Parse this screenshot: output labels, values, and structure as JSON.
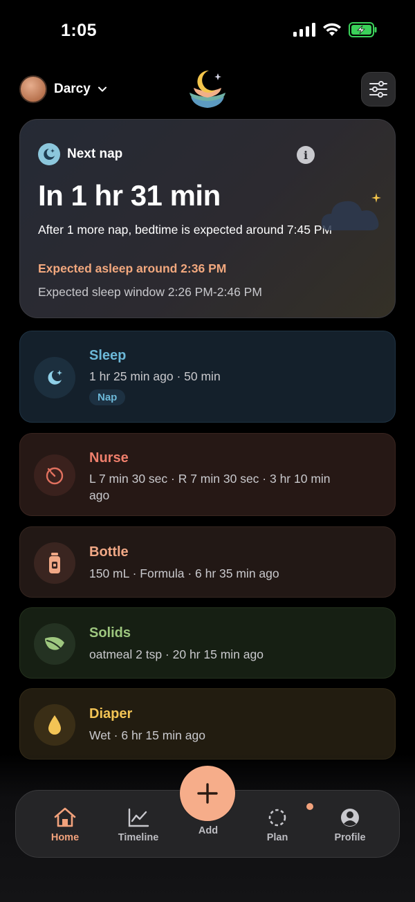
{
  "status_bar": {
    "time": "1:05"
  },
  "header": {
    "profile_name": "Darcy"
  },
  "next_nap": {
    "label": "Next nap",
    "countdown": "In 1 hr 31 min",
    "subtitle": "After 1 more nap, bedtime is expected around 7:45 PM",
    "expected_asleep": "Expected asleep around 2:36 PM",
    "sleep_window": "Expected sleep window 2:26 PM-2:46 PM"
  },
  "activities": {
    "sleep": {
      "title": "Sleep",
      "detail": "1 hr 25 min ago · 50 min",
      "tag": "Nap"
    },
    "nurse": {
      "title": "Nurse",
      "detail": "L 7 min 30 sec · R 7 min 30 sec · 3 hr 10 min ago"
    },
    "bottle": {
      "title": "Bottle",
      "detail": "150 mL · Formula · 6 hr 35 min ago"
    },
    "solids": {
      "title": "Solids",
      "detail": "oatmeal 2 tsp · 20 hr 15 min ago"
    },
    "diaper": {
      "title": "Diaper",
      "detail": "Wet · 6 hr 15 min ago"
    }
  },
  "tabs": {
    "home": "Home",
    "timeline": "Timeline",
    "add": "Add",
    "plan": "Plan",
    "profile": "Profile"
  },
  "colors": {
    "accent": "#f6ad8a",
    "sleep": "#6cb8d8",
    "nurse": "#ef7f6c",
    "bottle": "#f1a886",
    "solids": "#9ec77f",
    "diaper": "#f3c455"
  },
  "icons": {
    "status": [
      "cellular-signal-icon",
      "wifi-icon",
      "battery-charging-icon"
    ],
    "header": [
      "chevron-down-icon",
      "moon-logo-icon",
      "sliders-icon"
    ],
    "cards": [
      "moon-icon",
      "stopwatch-icon",
      "bottle-icon",
      "leaf-icon",
      "drop-icon"
    ],
    "tabs": [
      "home-icon",
      "chart-icon",
      "plus-icon",
      "plan-icon",
      "user-icon"
    ]
  }
}
